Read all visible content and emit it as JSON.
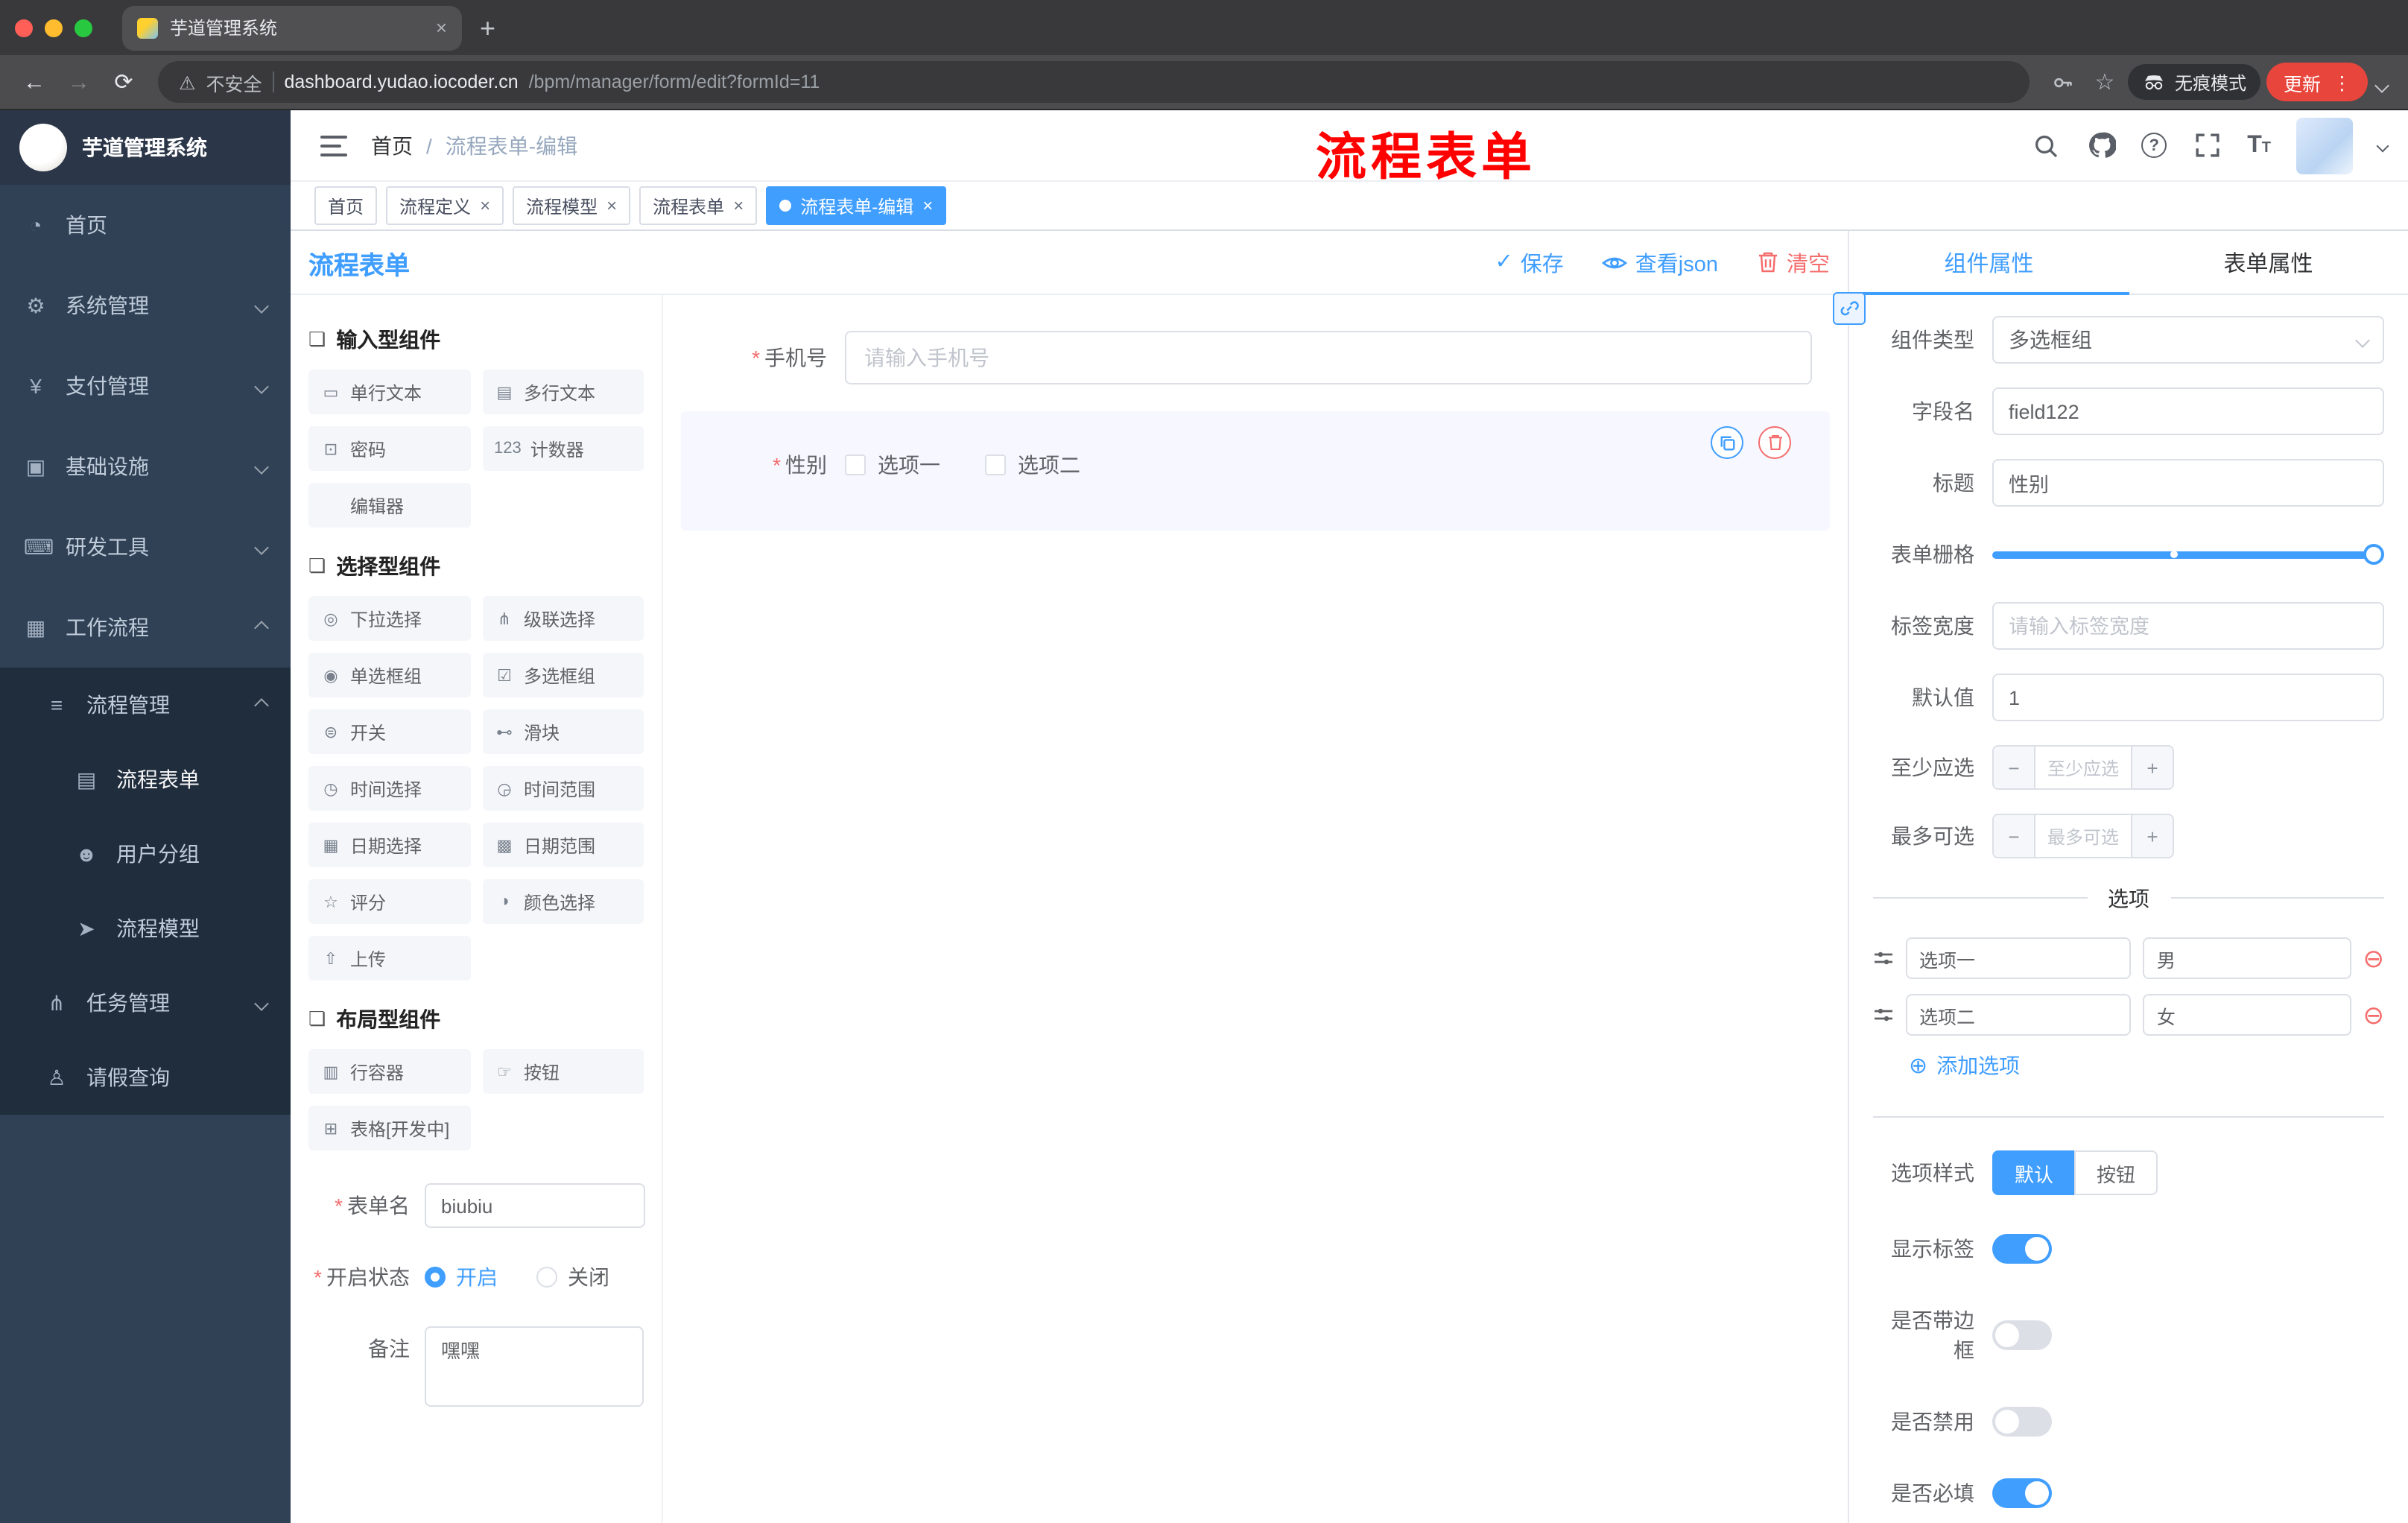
{
  "colors": {
    "primary": "#409EFF",
    "danger": "#F56C6C",
    "annotation": "#FF0000",
    "sidebar_bg": "#304156",
    "submenu_bg": "#1F2D3D",
    "active_tag": "#409EFF"
  },
  "glyphs": {
    "required": "*",
    "close": "×",
    "new_tab": "+",
    "back": "←",
    "forward": "→",
    "reload": "⟳",
    "warning": "⚠",
    "star": "☆",
    "kebab": "⋮",
    "check": "✓",
    "plus_circle": "⊕",
    "minus_circle": "⊖",
    "minus": "−",
    "plus": "+",
    "help": "?",
    "tsize_big": "T",
    "tsize_small": "T"
  },
  "browser": {
    "tab_title": "芋道管理系统",
    "security_label": "不安全",
    "url_domain": "dashboard.yudao.iocoder.cn",
    "url_path": "/bpm/manager/form/edit?formId=11",
    "incognito_label": "无痕模式",
    "update_label": "更新"
  },
  "sidebar": {
    "logo_title": "芋道管理系统",
    "items": [
      {
        "icon": "◔",
        "label": "首页"
      },
      {
        "icon": "⚙",
        "label": "系统管理"
      },
      {
        "icon": "¥",
        "label": "支付管理"
      },
      {
        "icon": "▣",
        "label": "基础设施"
      },
      {
        "icon": "⌨",
        "label": "研发工具"
      },
      {
        "icon": "▦",
        "label": "工作流程"
      },
      {
        "icon": "≡",
        "label": "流程管理"
      },
      {
        "icon": "▤",
        "label": "流程表单"
      },
      {
        "icon": "☻",
        "label": "用户分组"
      },
      {
        "icon": "➤",
        "label": "流程模型"
      },
      {
        "icon": "⋔",
        "label": "任务管理"
      },
      {
        "icon": "♙",
        "label": "请假查询"
      }
    ]
  },
  "navbar": {
    "breadcrumb_home": "首页",
    "breadcrumb_sep": "/",
    "breadcrumb_current": "流程表单-编辑",
    "annotation": "流程表单"
  },
  "tags": [
    {
      "label": "首页"
    },
    {
      "label": "流程定义"
    },
    {
      "label": "流程模型"
    },
    {
      "label": "流程表单"
    },
    {
      "label": "流程表单-编辑"
    }
  ],
  "designer": {
    "title": "流程表单",
    "save": "保存",
    "view_json": "查看json",
    "clear": "清空",
    "palette": {
      "groups": [
        {
          "icon": "❏",
          "title": "输入型组件",
          "items": [
            {
              "icon": "▭",
              "label": "单行文本"
            },
            {
              "icon": "▤",
              "label": "多行文本"
            },
            {
              "icon": "⊡",
              "label": "密码"
            },
            {
              "icon": "123",
              "label": "计数器"
            },
            {
              "icon": "",
              "label": "编辑器"
            }
          ]
        },
        {
          "icon": "❏",
          "title": "选择型组件",
          "items": [
            {
              "icon": "◎",
              "label": "下拉选择"
            },
            {
              "icon": "⋔",
              "label": "级联选择"
            },
            {
              "icon": "◉",
              "label": "单选框组"
            },
            {
              "icon": "☑",
              "label": "多选框组"
            },
            {
              "icon": "⊜",
              "label": "开关"
            },
            {
              "icon": "⊷",
              "label": "滑块"
            },
            {
              "icon": "◷",
              "label": "时间选择"
            },
            {
              "icon": "◶",
              "label": "时间范围"
            },
            {
              "icon": "▦",
              "label": "日期选择"
            },
            {
              "icon": "▩",
              "label": "日期范围"
            },
            {
              "icon": "☆",
              "label": "评分"
            },
            {
              "icon": "◑",
              "label": "颜色选择"
            },
            {
              "icon": "⇧",
              "label": "上传"
            }
          ]
        },
        {
          "icon": "❏",
          "title": "布局型组件",
          "items": [
            {
              "icon": "▥",
              "label": "行容器"
            },
            {
              "icon": "☞",
              "label": "按钮"
            },
            {
              "icon": "⊞",
              "label": "表格[开发中]"
            }
          ]
        }
      ]
    },
    "meta": {
      "form_name_label": "表单名",
      "form_name_value": "biubiu",
      "status_label": "开启状态",
      "status_on": "开启",
      "status_off": "关闭",
      "remark_label": "备注",
      "remark_value": "嘿嘿"
    },
    "canvas": {
      "phone": {
        "label": "手机号",
        "placeholder": "请输入手机号"
      },
      "gender": {
        "label": "性别",
        "option1": "选项一",
        "option2": "选项二"
      }
    }
  },
  "props": {
    "tab_component": "组件属性",
    "tab_form": "表单属性",
    "component_type_label": "组件类型",
    "component_type_value": "多选框组",
    "field_name_label": "字段名",
    "field_name_value": "field122",
    "title_label": "标题",
    "title_value": "性别",
    "grid_label": "表单栅格",
    "label_width_label": "标签宽度",
    "label_width_placeholder": "请输入标签宽度",
    "default_label": "默认值",
    "default_value": "1",
    "min_label": "至少应选",
    "min_placeholder": "至少应选",
    "max_label": "最多可选",
    "max_placeholder": "最多可选",
    "options_title": "选项",
    "options": [
      {
        "label": "选项一",
        "value": "男"
      },
      {
        "label": "选项二",
        "value": "女"
      }
    ],
    "add_option": "添加选项",
    "style_label": "选项样式",
    "style_default": "默认",
    "style_button": "按钮",
    "switches": [
      {
        "label": "显示标签",
        "on": true
      },
      {
        "label": "是否带边框",
        "on": false
      },
      {
        "label": "是否禁用",
        "on": false
      },
      {
        "label": "是否必填",
        "on": true
      }
    ]
  }
}
